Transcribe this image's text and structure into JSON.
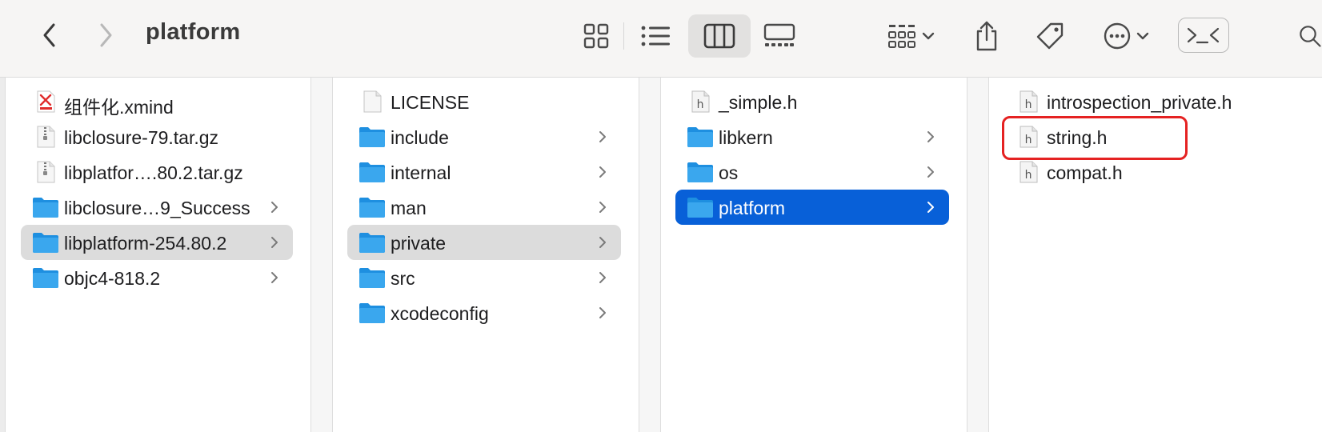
{
  "window": {
    "title": "platform"
  },
  "toolbar": {
    "back": "chevron-left-icon",
    "forward": "chevron-right-icon",
    "views": [
      "icon-view",
      "list-view",
      "column-view",
      "gallery-view"
    ],
    "active_view": "column-view",
    "tools": [
      "group-by-icon",
      "share-icon",
      "tag-icon",
      "more-actions-icon",
      "terminal-icon",
      "search-icon"
    ]
  },
  "columns": [
    {
      "items": [
        {
          "name": "组件化.xmind",
          "kind": "xmind"
        },
        {
          "name": "libclosure-79.tar.gz",
          "kind": "archive"
        },
        {
          "name": "libplatfor….80.2.tar.gz",
          "kind": "archive"
        },
        {
          "name": "libclosure…9_Success",
          "kind": "folder"
        },
        {
          "name": "libplatform-254.80.2",
          "kind": "folder",
          "selected": "gray"
        },
        {
          "name": "objc4-818.2",
          "kind": "folder"
        }
      ]
    },
    {
      "items": [
        {
          "name": "LICENSE",
          "kind": "doc"
        },
        {
          "name": "include",
          "kind": "folder"
        },
        {
          "name": "internal",
          "kind": "folder"
        },
        {
          "name": "man",
          "kind": "folder"
        },
        {
          "name": "private",
          "kind": "folder",
          "selected": "gray"
        },
        {
          "name": "src",
          "kind": "folder"
        },
        {
          "name": "xcodeconfig",
          "kind": "folder"
        }
      ]
    },
    {
      "items": [
        {
          "name": "_simple.h",
          "kind": "header"
        },
        {
          "name": "libkern",
          "kind": "folder"
        },
        {
          "name": "os",
          "kind": "folder"
        },
        {
          "name": "platform",
          "kind": "folder",
          "selected": "blue"
        }
      ]
    },
    {
      "items": [
        {
          "name": "introspection_private.h",
          "kind": "header"
        },
        {
          "name": "string.h",
          "kind": "header",
          "highlighted": true
        },
        {
          "name": "compat.h",
          "kind": "header"
        }
      ]
    }
  ],
  "colors": {
    "selection_blue": "#0860d8",
    "selection_gray": "#dcdcdc",
    "highlight_red": "#e52222",
    "folder_blue": "#3aa7ee"
  }
}
